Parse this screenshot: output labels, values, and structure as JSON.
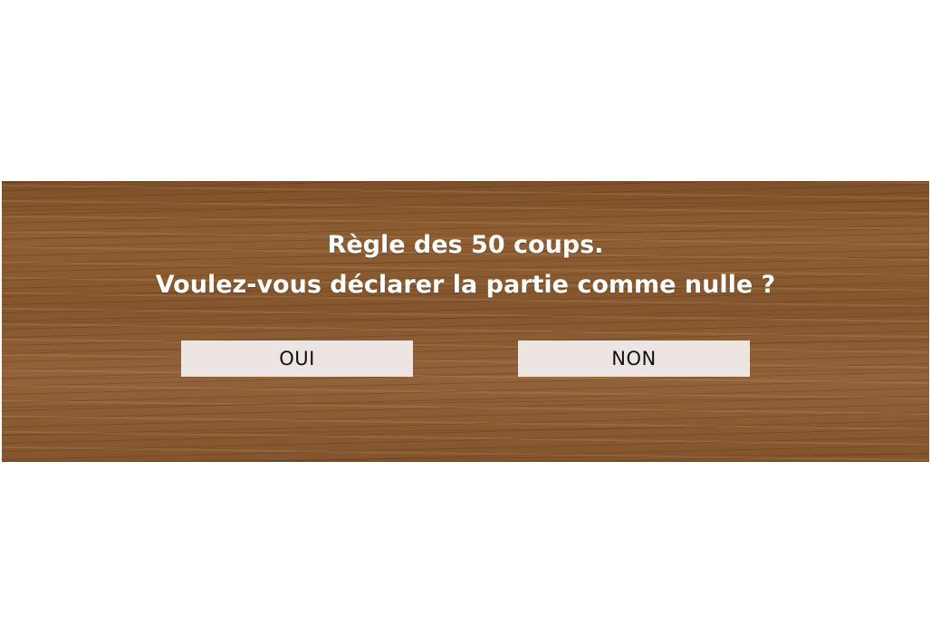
{
  "dialog": {
    "line1": "Règle des 50 coups.",
    "line2": "Voulez-vous déclarer la partie comme nulle ?",
    "yes_label": "OUI",
    "no_label": "NON"
  },
  "colors": {
    "panel": "#8a5a30",
    "button_bg": "#ece5e1",
    "button_text": "#111111",
    "message_text": "#ffffff"
  }
}
